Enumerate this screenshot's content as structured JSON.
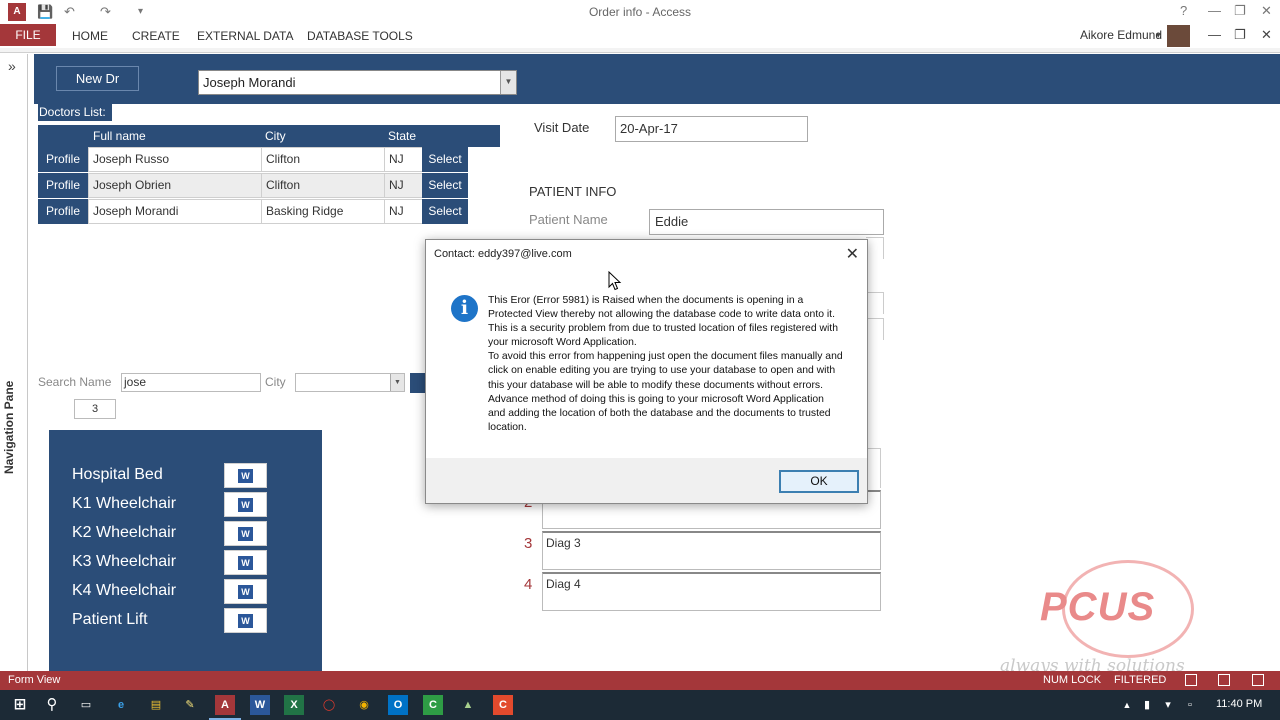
{
  "window": {
    "title": "Order info - Access",
    "app_icon_letter": "A",
    "help": "?"
  },
  "ribbon": {
    "file": "FILE",
    "tabs": [
      "HOME",
      "CREATE",
      "EXTERNAL DATA",
      "DATABASE TOOLS"
    ],
    "user": "Aikore Edmund"
  },
  "nav_pane": {
    "label": "Navigation Pane",
    "expand": "»"
  },
  "header": {
    "new_dr": "New Dr",
    "doctor_combo_value": "Joseph Morandi"
  },
  "doctors_list": {
    "label": "Doctors List:",
    "columns": [
      "Full name",
      "City",
      "State"
    ],
    "rows": [
      {
        "profile": "Profile",
        "name": "Joseph Russo",
        "city": "Clifton",
        "state": "NJ",
        "select": "Select"
      },
      {
        "profile": "Profile",
        "name": "Joseph Obrien",
        "city": "Clifton",
        "state": "NJ",
        "select": "Select"
      },
      {
        "profile": "Profile",
        "name": "Joseph Morandi",
        "city": "Basking Ridge",
        "state": "NJ",
        "select": "Select"
      }
    ]
  },
  "search": {
    "name_label": "Search Name",
    "name_value": "jose",
    "city_label": "City",
    "count": "3"
  },
  "equipment": [
    {
      "label": "Hospital Bed"
    },
    {
      "label": "K1 Wheelchair"
    },
    {
      "label": "K2 Wheelchair"
    },
    {
      "label": "K3 Wheelchair"
    },
    {
      "label": "K4 Wheelchair"
    },
    {
      "label": "Patient Lift"
    }
  ],
  "visit": {
    "label": "Visit Date",
    "value": "20-Apr-17"
  },
  "patient": {
    "section": "PATIENT INFO",
    "name_label": "Patient Name",
    "name_value": "Eddie"
  },
  "diagnoses": [
    {
      "num": "2",
      "text": ""
    },
    {
      "num": "3",
      "text": "Diag 3"
    },
    {
      "num": "4",
      "text": "Diag 4"
    }
  ],
  "dialog": {
    "title": "Contact: eddy397@live.com",
    "message": "This Eror (Error 5981) is Raised when the documents is opening in a Protected View thereby not allowing the database code to write data onto it. This is a security problem from due to trusted location of files registered with your microsoft Word Application.\nTo avoid this error from happening just open the document files manually and click on enable editing you are trying to use your database to open and with this your database will be able to modify these documents without errors. Advance method of doing this is going to your microsoft Word Application and adding the location of both the database and the documents to trusted location.",
    "ok": "OK"
  },
  "watermark": {
    "brand": "PCUS",
    "tagline": "always with solutions"
  },
  "statusbar": {
    "view": "Form View",
    "num_lock": "NUM LOCK",
    "filtered": "FILTERED"
  },
  "taskbar": {
    "clock": "11:40 PM"
  },
  "colors": {
    "form_blue": "#2b4d78",
    "access_red": "#a4373a"
  }
}
